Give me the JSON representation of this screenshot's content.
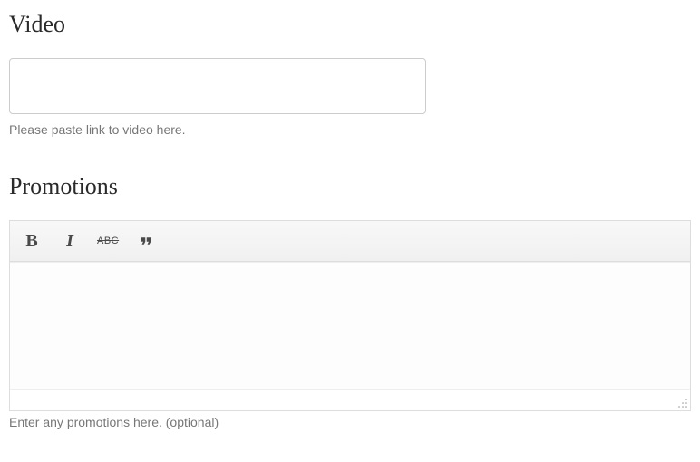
{
  "video": {
    "heading": "Video",
    "value": "",
    "help": "Please paste link to video here."
  },
  "promotions": {
    "heading": "Promotions",
    "toolbar": {
      "bold": "B",
      "italic": "I",
      "strike": "ABC"
    },
    "content": "",
    "help": "Enter any promotions here. (optional)"
  }
}
